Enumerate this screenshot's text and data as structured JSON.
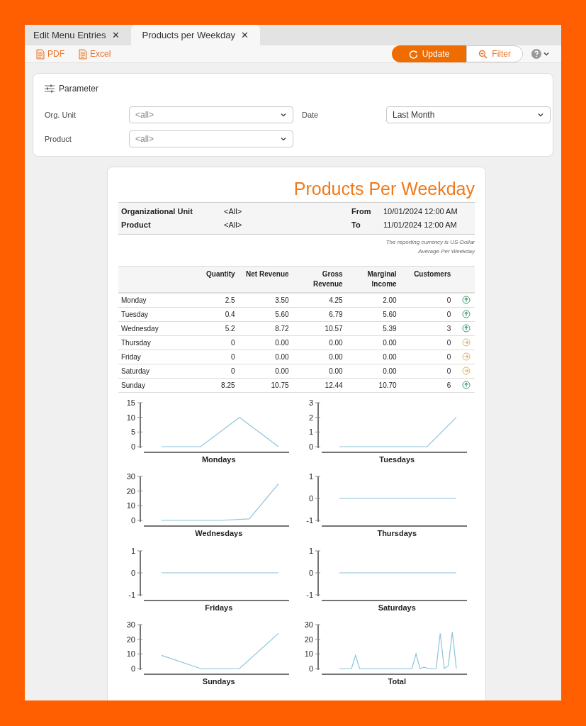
{
  "tabs": [
    {
      "label": "Edit Menu Entries",
      "selected": false,
      "close": "✕"
    },
    {
      "label": "Products per Weekday",
      "selected": true,
      "close": "✕"
    }
  ],
  "toolbar": {
    "exports": [
      "PDF",
      "Excel"
    ],
    "update": "Update",
    "filter": "Filter"
  },
  "parameter": {
    "title": "Parameter",
    "fields": [
      {
        "label": "Org. Unit",
        "placeholder": "<all>"
      },
      {
        "label": "Date",
        "value": "Last Month"
      },
      {
        "label": "Product",
        "placeholder": "<all>"
      }
    ]
  },
  "report": {
    "title": "Products Per Weekday",
    "header": [
      {
        "label": "Organizational Unit",
        "value": "<All>",
        "label2": "From",
        "value2": "10/01/2024 12:00 AM"
      },
      {
        "label": "Product",
        "value": "<All>",
        "label2": "To",
        "value2": "11/01/2024 12:00 AM"
      }
    ],
    "notes": [
      "The reporting currency is US-Dollar",
      "Average Per Weekday"
    ],
    "table": {
      "columns": [
        "Quantity",
        "Net Revenue",
        "Gross Revenue",
        "Marginal Income",
        "Customers"
      ],
      "rows": [
        {
          "day": "Monday",
          "cells": [
            "2.5",
            "3.50",
            "4.25",
            "2.00",
            "0"
          ],
          "rising": true
        },
        {
          "day": "Tuesday",
          "cells": [
            "0.4",
            "5.60",
            "6.79",
            "5.60",
            "0"
          ],
          "rising": true
        },
        {
          "day": "Wednesday",
          "cells": [
            "5.2",
            "8.72",
            "10.57",
            "5.39",
            "3"
          ],
          "rising": true
        },
        {
          "day": "Thursday",
          "cells": [
            "0",
            "0.00",
            "0.00",
            "0.00",
            "0"
          ],
          "rising": false
        },
        {
          "day": "Friday",
          "cells": [
            "0",
            "0.00",
            "0.00",
            "0.00",
            "0"
          ],
          "rising": false
        },
        {
          "day": "Saturday",
          "cells": [
            "0",
            "0.00",
            "0.00",
            "0.00",
            "0"
          ],
          "rising": false
        },
        {
          "day": "Sunday",
          "cells": [
            "8.25",
            "10.75",
            "12.44",
            "10.70",
            "6"
          ],
          "rising": true
        }
      ]
    },
    "charts": [
      {
        "chart_data": {
          "type": "line",
          "xlabel": "Mondays",
          "categories": [
            null,
            null,
            null,
            null
          ],
          "series": [
            {
              "color": "#8cc4dc",
              "values": [
                0,
                0,
                10,
                0
              ]
            }
          ],
          "ylim": [
            0,
            15
          ],
          "yticks": [
            0,
            5,
            10,
            15
          ]
        }
      },
      {
        "chart_data": {
          "type": "line",
          "xlabel": "Tuesdays",
          "categories": [
            null,
            null,
            null,
            null,
            null
          ],
          "series": [
            {
              "color": "#8cc4dc",
              "values": [
                0,
                0,
                0,
                0,
                2
              ]
            }
          ],
          "ylim": [
            0,
            3
          ],
          "yticks": [
            0,
            1,
            2,
            3
          ]
        }
      },
      {
        "chart_data": {
          "type": "line",
          "xlabel": "Wednesdays",
          "categories": [
            null,
            null,
            null,
            null,
            null
          ],
          "series": [
            {
              "color": "#8cc4dc",
              "values": [
                0,
                0,
                0,
                1,
                25
              ]
            }
          ],
          "ylim": [
            0,
            30
          ],
          "yticks": [
            0,
            10,
            20,
            30
          ]
        }
      },
      {
        "chart_data": {
          "type": "line",
          "xlabel": "Thursdays",
          "categories": [
            null,
            null,
            null,
            null,
            null
          ],
          "series": [
            {
              "color": "#8cc4dc",
              "values": [
                0,
                0,
                0,
                0,
                0
              ]
            }
          ],
          "ylim": [
            -1,
            1
          ],
          "yticks": [
            -1,
            0,
            1
          ]
        }
      },
      {
        "chart_data": {
          "type": "line",
          "xlabel": "Fridays",
          "categories": [
            null,
            null,
            null,
            null
          ],
          "series": [
            {
              "color": "#8cc4dc",
              "values": [
                0,
                0,
                0,
                0
              ]
            }
          ],
          "ylim": [
            -1,
            1
          ],
          "yticks": [
            -1,
            0,
            1
          ]
        }
      },
      {
        "chart_data": {
          "type": "line",
          "xlabel": "Saturdays",
          "categories": [
            null,
            null,
            null,
            null,
            null
          ],
          "series": [
            {
              "color": "#8cc4dc",
              "values": [
                0,
                0,
                0,
                0,
                0
              ]
            }
          ],
          "ylim": [
            -1,
            1
          ],
          "yticks": [
            -1,
            0,
            1
          ]
        }
      },
      {
        "chart_data": {
          "type": "line",
          "xlabel": "Sundays",
          "categories": [
            null,
            null,
            null,
            null
          ],
          "series": [
            {
              "color": "#8cc4dc",
              "values": [
                9,
                0,
                0,
                24
              ]
            }
          ],
          "ylim": [
            0,
            30
          ],
          "yticks": [
            0,
            10,
            20,
            30
          ]
        }
      },
      {
        "chart_data": {
          "type": "line",
          "xlabel": "Total",
          "categories": [
            null,
            null,
            null,
            null,
            null,
            null,
            null,
            null,
            null,
            null,
            null,
            null,
            null,
            null,
            null,
            null,
            null,
            null,
            null,
            null,
            null,
            null,
            null,
            null,
            null,
            null,
            null,
            null,
            null,
            null
          ],
          "series": [
            {
              "color": "#8cc4dc",
              "values": [
                0,
                0,
                0,
                0,
                9,
                0,
                0,
                0,
                0,
                0,
                0,
                0,
                0,
                0,
                0,
                0,
                0,
                0,
                0,
                10,
                0,
                1,
                0,
                0,
                0,
                24,
                0,
                2,
                25,
                0
              ]
            }
          ],
          "ylim": [
            0,
            30
          ],
          "yticks": [
            0,
            10,
            20,
            30
          ]
        }
      }
    ]
  }
}
